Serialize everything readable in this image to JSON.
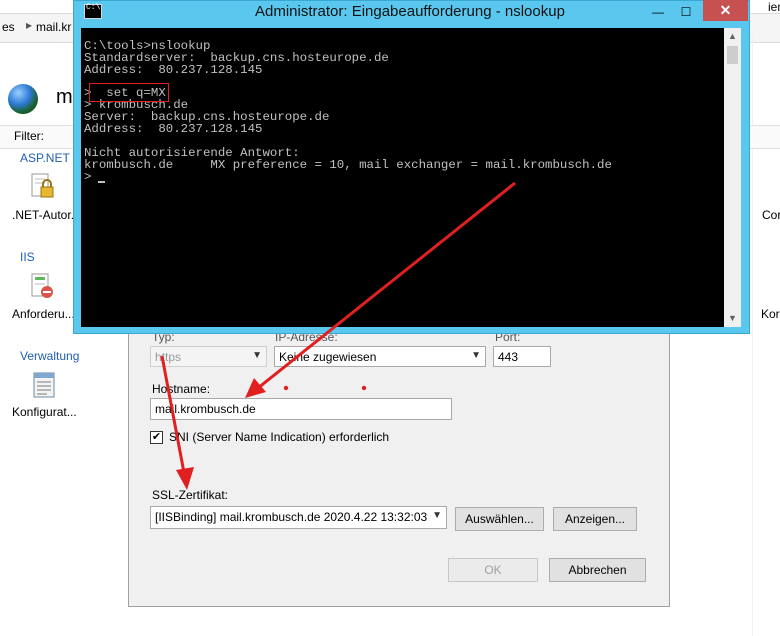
{
  "iis": {
    "breadcrumb_prefix": "es",
    "breadcrumb_site": "mail.kr",
    "right_fragment": "iens",
    "site_title": "m",
    "filter_label": "Filter:",
    "groups": {
      "aspnet": "ASP.NET",
      "iis": "IIS",
      "verwaltung": "Verwaltung"
    },
    "features": {
      "netauth": ".NET-Autor...",
      "anford": "Anforderu...",
      "konfig": "Konfigurat...",
      "right1a": ".",
      "right1b": "Cor",
      "right2": "Kor"
    }
  },
  "cmd": {
    "title": "Administrator: Eingabeaufforderung - nslookup",
    "icon_text": "C:\\",
    "min_label": "—",
    "max_label": "☐",
    "close_label": "✕",
    "lines": [
      "C:\\tools>nslookup",
      "Standardserver:  backup.cns.hosteurope.de",
      "Address:  80.237.128.145",
      ">  set q=MX",
      "> krombusch.de",
      "Server:  backup.cns.hosteurope.de",
      "Address:  80.237.128.145",
      "Nicht autorisierende Antwort:",
      "krombusch.de     MX preference = 10, mail exchanger = mail.krombusch.de",
      ">"
    ]
  },
  "dialog": {
    "typ_label": "Typ:",
    "ip_label": "IP-Adresse:",
    "port_label": "Port:",
    "typ_value": "https",
    "ip_value": "Keine zugewiesen",
    "port_value": "443",
    "host_label": "Hostname:",
    "host_value": "mail.krombusch.de",
    "sni_checked": "✔",
    "sni_label": "SNI (Server Name Indication) erforderlich",
    "cert_label": "SSL-Zertifikat:",
    "cert_value": "[IISBinding] mail.krombusch.de 2020.4.22 13:32:03",
    "select_button": "Auswählen...",
    "show_button": "Anzeigen...",
    "ok_button": "OK",
    "cancel_button": "Abbrechen"
  },
  "colors": {
    "annotation": "#e02020",
    "cmd_border": "#5ac8ee",
    "group_link": "#1f5fb0"
  }
}
